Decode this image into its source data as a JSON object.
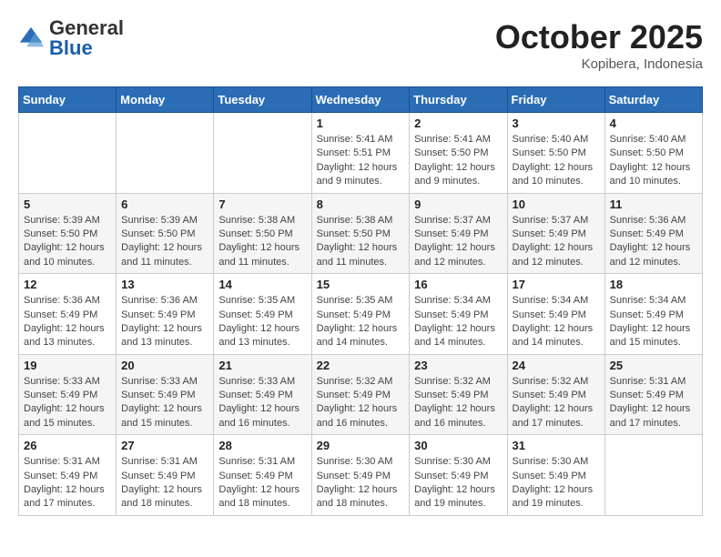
{
  "header": {
    "logo_general": "General",
    "logo_blue": "Blue",
    "month": "October 2025",
    "location": "Kopibera, Indonesia"
  },
  "weekdays": [
    "Sunday",
    "Monday",
    "Tuesday",
    "Wednesday",
    "Thursday",
    "Friday",
    "Saturday"
  ],
  "weeks": [
    [
      {
        "day": "",
        "info": ""
      },
      {
        "day": "",
        "info": ""
      },
      {
        "day": "",
        "info": ""
      },
      {
        "day": "1",
        "info": "Sunrise: 5:41 AM\nSunset: 5:51 PM\nDaylight: 12 hours and 9 minutes."
      },
      {
        "day": "2",
        "info": "Sunrise: 5:41 AM\nSunset: 5:50 PM\nDaylight: 12 hours and 9 minutes."
      },
      {
        "day": "3",
        "info": "Sunrise: 5:40 AM\nSunset: 5:50 PM\nDaylight: 12 hours and 10 minutes."
      },
      {
        "day": "4",
        "info": "Sunrise: 5:40 AM\nSunset: 5:50 PM\nDaylight: 12 hours and 10 minutes."
      }
    ],
    [
      {
        "day": "5",
        "info": "Sunrise: 5:39 AM\nSunset: 5:50 PM\nDaylight: 12 hours and 10 minutes."
      },
      {
        "day": "6",
        "info": "Sunrise: 5:39 AM\nSunset: 5:50 PM\nDaylight: 12 hours and 11 minutes."
      },
      {
        "day": "7",
        "info": "Sunrise: 5:38 AM\nSunset: 5:50 PM\nDaylight: 12 hours and 11 minutes."
      },
      {
        "day": "8",
        "info": "Sunrise: 5:38 AM\nSunset: 5:50 PM\nDaylight: 12 hours and 11 minutes."
      },
      {
        "day": "9",
        "info": "Sunrise: 5:37 AM\nSunset: 5:49 PM\nDaylight: 12 hours and 12 minutes."
      },
      {
        "day": "10",
        "info": "Sunrise: 5:37 AM\nSunset: 5:49 PM\nDaylight: 12 hours and 12 minutes."
      },
      {
        "day": "11",
        "info": "Sunrise: 5:36 AM\nSunset: 5:49 PM\nDaylight: 12 hours and 12 minutes."
      }
    ],
    [
      {
        "day": "12",
        "info": "Sunrise: 5:36 AM\nSunset: 5:49 PM\nDaylight: 12 hours and 13 minutes."
      },
      {
        "day": "13",
        "info": "Sunrise: 5:36 AM\nSunset: 5:49 PM\nDaylight: 12 hours and 13 minutes."
      },
      {
        "day": "14",
        "info": "Sunrise: 5:35 AM\nSunset: 5:49 PM\nDaylight: 12 hours and 13 minutes."
      },
      {
        "day": "15",
        "info": "Sunrise: 5:35 AM\nSunset: 5:49 PM\nDaylight: 12 hours and 14 minutes."
      },
      {
        "day": "16",
        "info": "Sunrise: 5:34 AM\nSunset: 5:49 PM\nDaylight: 12 hours and 14 minutes."
      },
      {
        "day": "17",
        "info": "Sunrise: 5:34 AM\nSunset: 5:49 PM\nDaylight: 12 hours and 14 minutes."
      },
      {
        "day": "18",
        "info": "Sunrise: 5:34 AM\nSunset: 5:49 PM\nDaylight: 12 hours and 15 minutes."
      }
    ],
    [
      {
        "day": "19",
        "info": "Sunrise: 5:33 AM\nSunset: 5:49 PM\nDaylight: 12 hours and 15 minutes."
      },
      {
        "day": "20",
        "info": "Sunrise: 5:33 AM\nSunset: 5:49 PM\nDaylight: 12 hours and 15 minutes."
      },
      {
        "day": "21",
        "info": "Sunrise: 5:33 AM\nSunset: 5:49 PM\nDaylight: 12 hours and 16 minutes."
      },
      {
        "day": "22",
        "info": "Sunrise: 5:32 AM\nSunset: 5:49 PM\nDaylight: 12 hours and 16 minutes."
      },
      {
        "day": "23",
        "info": "Sunrise: 5:32 AM\nSunset: 5:49 PM\nDaylight: 12 hours and 16 minutes."
      },
      {
        "day": "24",
        "info": "Sunrise: 5:32 AM\nSunset: 5:49 PM\nDaylight: 12 hours and 17 minutes."
      },
      {
        "day": "25",
        "info": "Sunrise: 5:31 AM\nSunset: 5:49 PM\nDaylight: 12 hours and 17 minutes."
      }
    ],
    [
      {
        "day": "26",
        "info": "Sunrise: 5:31 AM\nSunset: 5:49 PM\nDaylight: 12 hours and 17 minutes."
      },
      {
        "day": "27",
        "info": "Sunrise: 5:31 AM\nSunset: 5:49 PM\nDaylight: 12 hours and 18 minutes."
      },
      {
        "day": "28",
        "info": "Sunrise: 5:31 AM\nSunset: 5:49 PM\nDaylight: 12 hours and 18 minutes."
      },
      {
        "day": "29",
        "info": "Sunrise: 5:30 AM\nSunset: 5:49 PM\nDaylight: 12 hours and 18 minutes."
      },
      {
        "day": "30",
        "info": "Sunrise: 5:30 AM\nSunset: 5:49 PM\nDaylight: 12 hours and 19 minutes."
      },
      {
        "day": "31",
        "info": "Sunrise: 5:30 AM\nSunset: 5:49 PM\nDaylight: 12 hours and 19 minutes."
      },
      {
        "day": "",
        "info": ""
      }
    ]
  ]
}
